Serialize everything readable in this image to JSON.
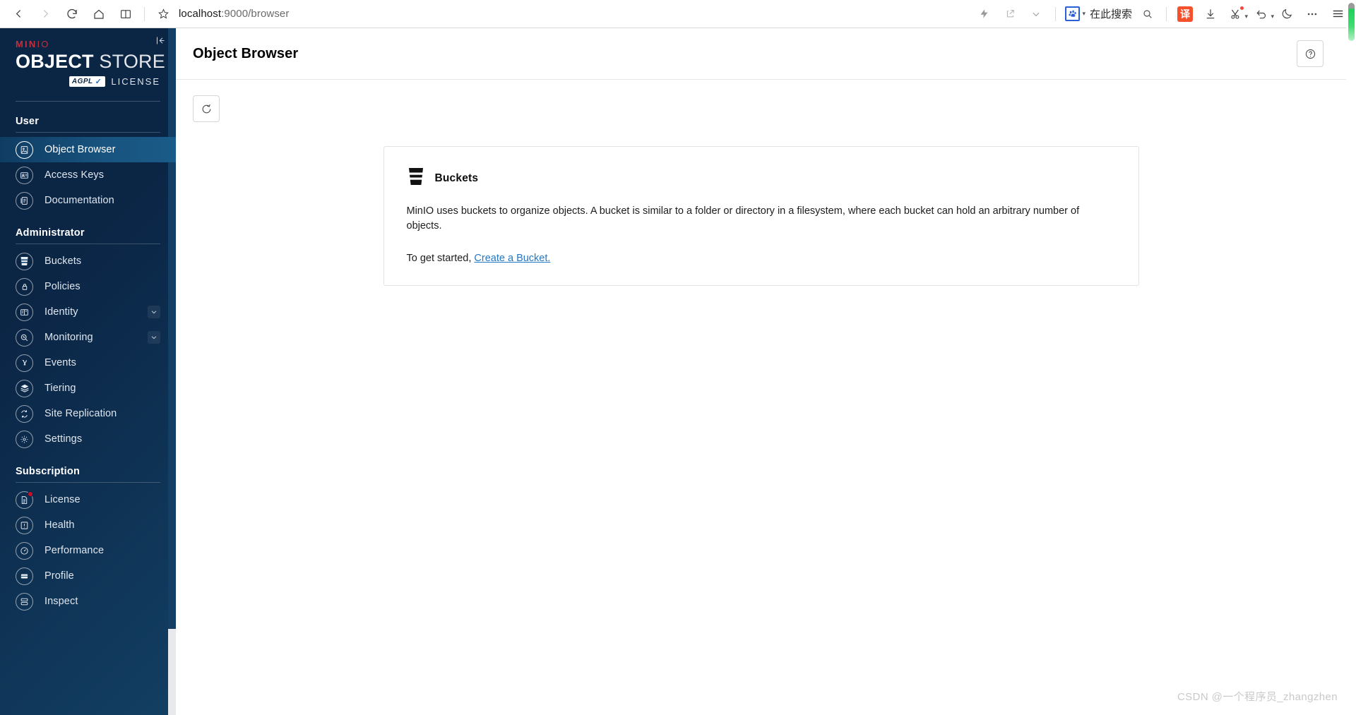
{
  "browser": {
    "back_icon": "back-arrow-icon",
    "forward_icon": "forward-arrow-icon",
    "reload_icon": "reload-icon",
    "home_icon": "home-icon",
    "reader_icon": "book-reader-icon",
    "bookmark_icon": "star-bookmark-icon",
    "url": "localhost:9000/browser",
    "url_host": "localhost",
    "url_path": ":9000/browser",
    "lightning_icon": "lightning-bolt-icon",
    "share_icon": "share-out-icon",
    "chevron_icon": "chevron-down-icon",
    "search_engine_icon": "paw-print-icon",
    "search_placeholder": "在此搜索",
    "search_icon": "search-icon",
    "translate_label": "译",
    "download_icon": "download-icon",
    "scissors_icon": "scissors-icon",
    "undo_icon": "undo-arrow-icon",
    "moon_icon": "moon-icon",
    "more_icon": "ellipsis-icon",
    "menu_icon": "hamburger-menu-icon"
  },
  "sidebar": {
    "logo": {
      "brand": "MIN",
      "brand_suffix": "IO",
      "title_bold": "OBJECT",
      "title_light": " STORE",
      "license_chip": "AGPL",
      "license_word": "LICENSE",
      "collapse_icon": "collapse-sidebar-icon"
    },
    "sections": [
      {
        "title": "User",
        "items": [
          {
            "label": "Object Browser",
            "icon": "object-browser-icon",
            "active": true,
            "chevron": false,
            "badge": false
          },
          {
            "label": "Access Keys",
            "icon": "access-keys-icon",
            "active": false,
            "chevron": false,
            "badge": false
          },
          {
            "label": "Documentation",
            "icon": "documentation-icon",
            "active": false,
            "chevron": false,
            "badge": false
          }
        ]
      },
      {
        "title": "Administrator",
        "items": [
          {
            "label": "Buckets",
            "icon": "bucket-icon",
            "active": false,
            "chevron": false,
            "badge": false
          },
          {
            "label": "Policies",
            "icon": "policies-lock-icon",
            "active": false,
            "chevron": false,
            "badge": false
          },
          {
            "label": "Identity",
            "icon": "identity-icon",
            "active": false,
            "chevron": true,
            "badge": false
          },
          {
            "label": "Monitoring",
            "icon": "monitoring-icon",
            "active": false,
            "chevron": true,
            "badge": false
          },
          {
            "label": "Events",
            "icon": "lambda-icon",
            "active": false,
            "chevron": false,
            "badge": false
          },
          {
            "label": "Tiering",
            "icon": "tiering-layers-icon",
            "active": false,
            "chevron": false,
            "badge": false
          },
          {
            "label": "Site Replication",
            "icon": "site-replication-icon",
            "active": false,
            "chevron": false,
            "badge": false
          },
          {
            "label": "Settings",
            "icon": "gear-icon",
            "active": false,
            "chevron": false,
            "badge": false
          }
        ]
      },
      {
        "title": "Subscription",
        "items": [
          {
            "label": "License",
            "icon": "license-document-icon",
            "active": false,
            "chevron": false,
            "badge": true
          },
          {
            "label": "Health",
            "icon": "health-icon",
            "active": false,
            "chevron": false,
            "badge": false
          },
          {
            "label": "Performance",
            "icon": "performance-gauge-icon",
            "active": false,
            "chevron": false,
            "badge": false
          },
          {
            "label": "Profile",
            "icon": "profile-icon",
            "active": false,
            "chevron": false,
            "badge": false
          },
          {
            "label": "Inspect",
            "icon": "inspect-icon",
            "active": false,
            "chevron": false,
            "badge": false
          }
        ]
      }
    ]
  },
  "page": {
    "title": "Object Browser",
    "help_icon": "help-question-icon",
    "refresh_icon": "refresh-icon"
  },
  "card": {
    "icon": "bucket-icon",
    "title": "Buckets",
    "body": "MinIO uses buckets to organize objects. A bucket is similar to a folder or directory in a filesystem, where each bucket can hold an arbitrary number of objects.",
    "cta_prefix": "To get started, ",
    "cta_link": "Create a Bucket.",
    "link_color": "#2478c6"
  },
  "watermark": "CSDN @一个程序员_zhangzhen",
  "colors": {
    "sidebar_dark": "#0b2545",
    "sidebar_light": "#123f63",
    "active_nav": "#18547f",
    "brand_red": "#c72e3b",
    "scrollbar_green": "#3ddc6f"
  }
}
